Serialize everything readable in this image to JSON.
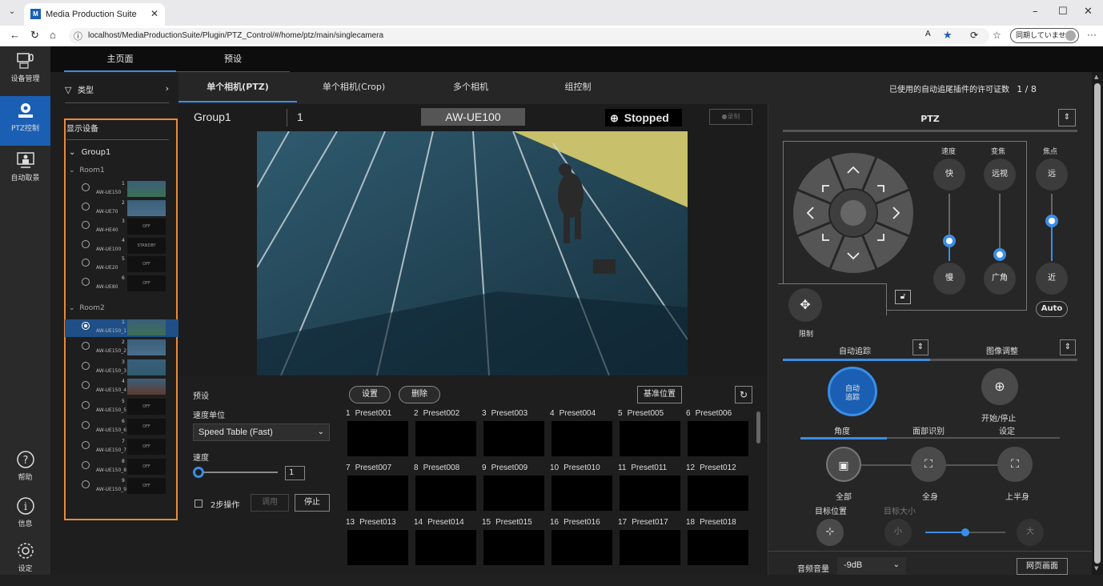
{
  "browser": {
    "tab_title": "Media Production Suite",
    "url": "localhost/MediaProductionSuite/Plugin/PTZ_Control/#/home/ptz/main/singlecamera",
    "sync_label": "同期していません"
  },
  "nav": {
    "items": [
      {
        "label": "设备管理"
      },
      {
        "label": "PTZ控制"
      },
      {
        "label": "自动取景"
      },
      {
        "label": "帮助"
      },
      {
        "label": "信息"
      },
      {
        "label": "设定"
      }
    ]
  },
  "top_tabs": [
    "主页面",
    "预设"
  ],
  "filter": {
    "label": "类型"
  },
  "devices": {
    "header": "显示设备",
    "group": "Group1",
    "room1": {
      "name": "Room1",
      "items": [
        {
          "num": "1",
          "name": "AW-UE150",
          "thumb": ""
        },
        {
          "num": "2",
          "name": "AW-UE70",
          "thumb": ""
        },
        {
          "num": "3",
          "name": "AW-HE40",
          "thumb": "OFF"
        },
        {
          "num": "4",
          "name": "AW-UE100",
          "thumb": "STANDBY"
        },
        {
          "num": "5",
          "name": "AW-UE20",
          "thumb": "OFF"
        },
        {
          "num": "6",
          "name": "AW-UE80",
          "thumb": "OFF"
        }
      ]
    },
    "room2": {
      "name": "Room2",
      "items": [
        {
          "num": "1",
          "name": "AW-UE150_1",
          "thumb": ""
        },
        {
          "num": "2",
          "name": "AW-UE150_2",
          "thumb": ""
        },
        {
          "num": "3",
          "name": "AW-UE150_3",
          "thumb": ""
        },
        {
          "num": "4",
          "name": "AW-UE150_4",
          "thumb": ""
        },
        {
          "num": "5",
          "name": "AW-UE150_5",
          "thumb": "OFF"
        },
        {
          "num": "6",
          "name": "AW-UE150_6",
          "thumb": "OFF"
        },
        {
          "num": "7",
          "name": "AW-UE150_7",
          "thumb": "OFF"
        },
        {
          "num": "8",
          "name": "AW-UE150_8",
          "thumb": "OFF"
        },
        {
          "num": "9",
          "name": "AW-UE150_9",
          "thumb": "OFF"
        }
      ]
    }
  },
  "sub_tabs": [
    "单个相机(PTZ)",
    "单个相机(Crop)",
    "多个相机",
    "组控制"
  ],
  "license": {
    "label": "已使用的自动追尾插件的许可证数",
    "value": "1 / 8"
  },
  "camera": {
    "group": "Group1",
    "number": "1",
    "model": "AW-UE100",
    "status": "Stopped",
    "rec_label": "●录制"
  },
  "preset_ctrl": {
    "title": "预设",
    "speed_unit_label": "速度单位",
    "speed_table": "Speed Table (Fast)",
    "speed_label": "速度",
    "speed_value": "1",
    "two_step": "2步操作",
    "recall": "调用",
    "stop": "停止",
    "set": "设置",
    "delete": "删除",
    "home": "基准位置"
  },
  "presets": [
    {
      "n": "1",
      "name": "Preset001"
    },
    {
      "n": "2",
      "name": "Preset002"
    },
    {
      "n": "3",
      "name": "Preset003"
    },
    {
      "n": "4",
      "name": "Preset004"
    },
    {
      "n": "5",
      "name": "Preset005"
    },
    {
      "n": "6",
      "name": "Preset006"
    },
    {
      "n": "7",
      "name": "Preset007"
    },
    {
      "n": "8",
      "name": "Preset008"
    },
    {
      "n": "9",
      "name": "Preset009"
    },
    {
      "n": "10",
      "name": "Preset010"
    },
    {
      "n": "11",
      "name": "Preset011"
    },
    {
      "n": "12",
      "name": "Preset012"
    },
    {
      "n": "13",
      "name": "Preset013"
    },
    {
      "n": "14",
      "name": "Preset014"
    },
    {
      "n": "15",
      "name": "Preset015"
    },
    {
      "n": "16",
      "name": "Preset016"
    },
    {
      "n": "17",
      "name": "Preset017"
    },
    {
      "n": "18",
      "name": "Preset018"
    }
  ],
  "ptz": {
    "title": "PTZ",
    "speed": "速度",
    "zoom": "变焦",
    "focus": "焦点",
    "fast": "快",
    "slow": "慢",
    "tele": "远视",
    "wide": "广角",
    "far": "远",
    "near": "近",
    "auto": "Auto",
    "limit": "限制",
    "speed_level": 0.3,
    "zoom_level": 0.1,
    "focus_level": 0.6
  },
  "tracking": {
    "tab1": "自动追踪",
    "tab2": "图像调整",
    "auto_btn": "自动追踪",
    "start_stop": "开始/停止",
    "angle_tabs": [
      "角度",
      "面部识别",
      "设定"
    ],
    "full": "全部",
    "body": "全身",
    "upper": "上半身",
    "target_pos": "目标位置",
    "target_size": "目标大小",
    "small": "小",
    "large": "大"
  },
  "audio": {
    "label": "音频音量",
    "value": "-9dB",
    "web_btn": "网页画面"
  }
}
